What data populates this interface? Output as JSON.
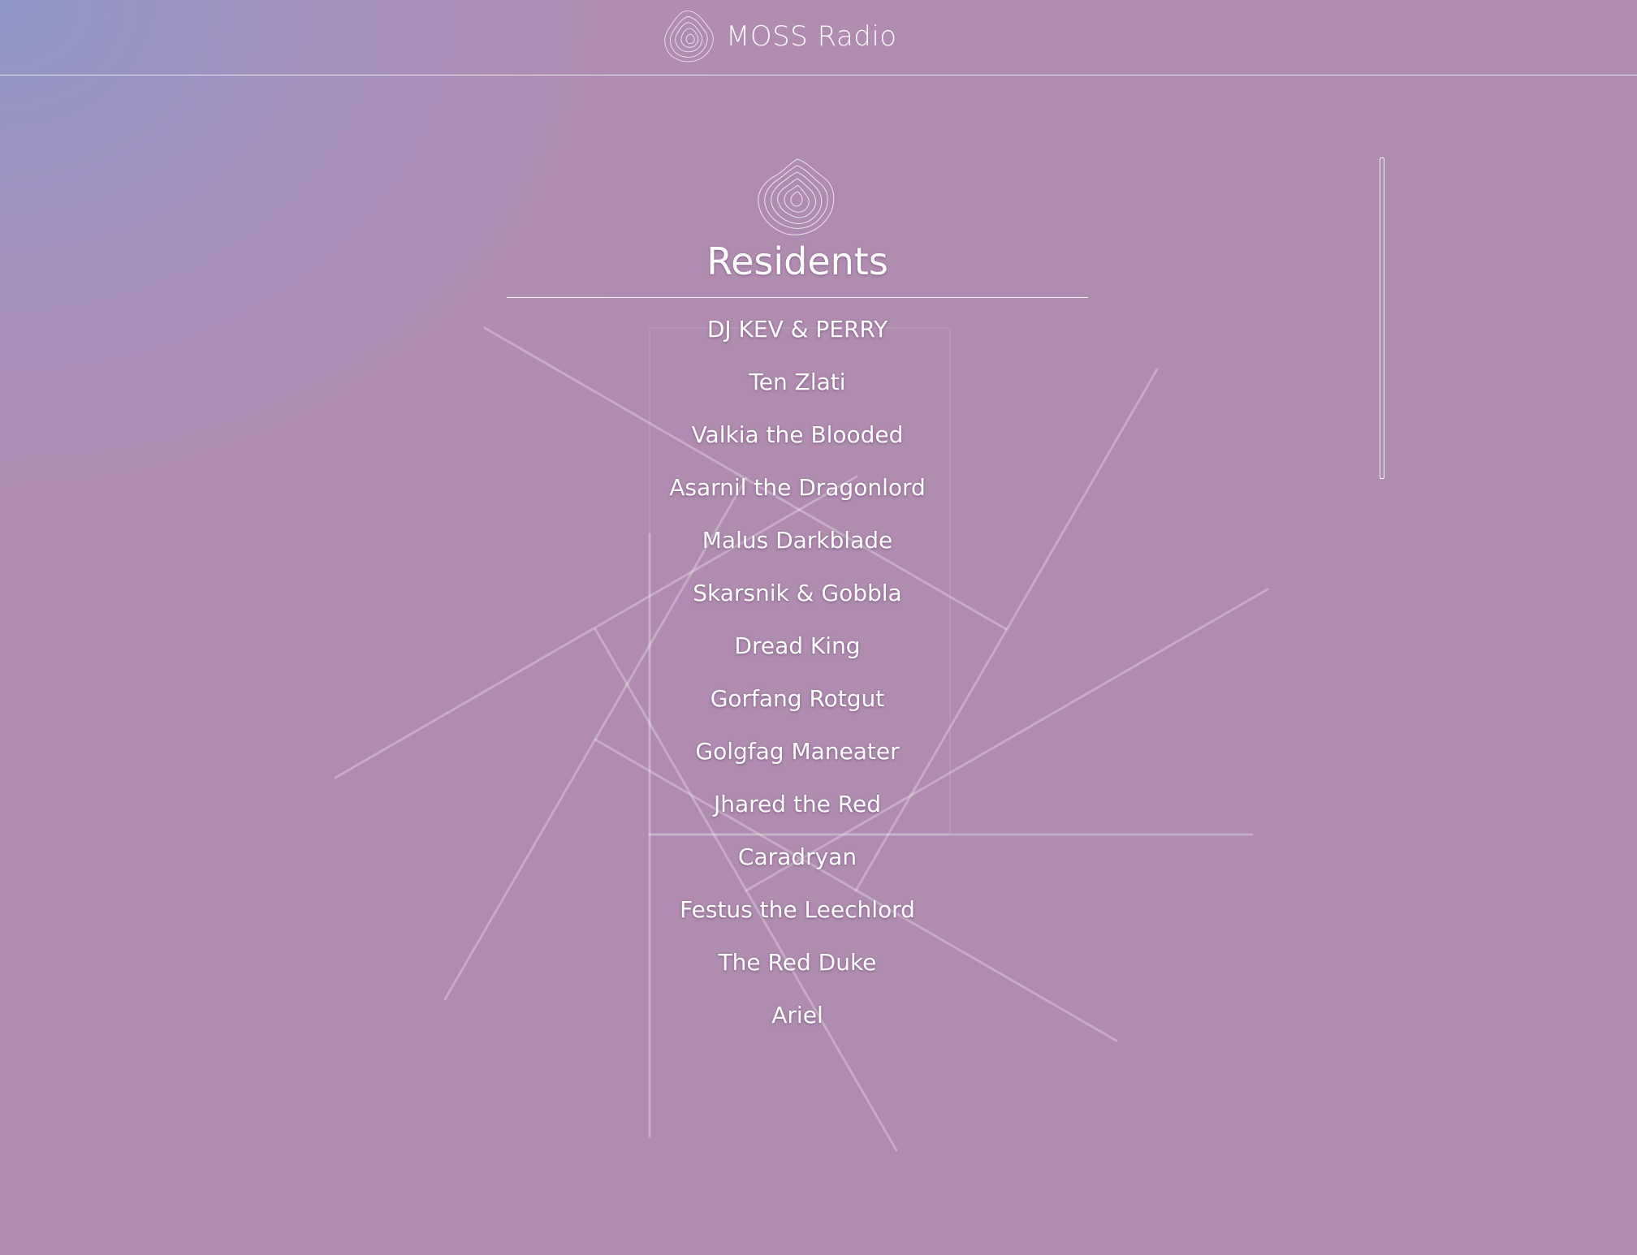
{
  "header": {
    "brand_title": "MOSS Radio",
    "logo_icon": "wave-contour-logo-icon"
  },
  "residents_section": {
    "icon": "wave-contour-logo-icon",
    "title": "Residents",
    "items": [
      "DJ KEV & PERRY",
      "Ten Zlati",
      "Valkia the Blooded",
      "Asarnil the Dragonlord",
      "Malus Darkblade",
      "Skarsnik & Gobbla",
      "Dread King",
      "Gorfang Rotgut",
      "Golgfag Maneater",
      "Jhared the Red",
      "Caradryan",
      "Festus the Leechlord",
      "The Red Duke",
      "Ariel"
    ]
  },
  "colors": {
    "background_corner": "#8e97c6",
    "background_main": "#b08cb0",
    "text": "#ffffff"
  }
}
